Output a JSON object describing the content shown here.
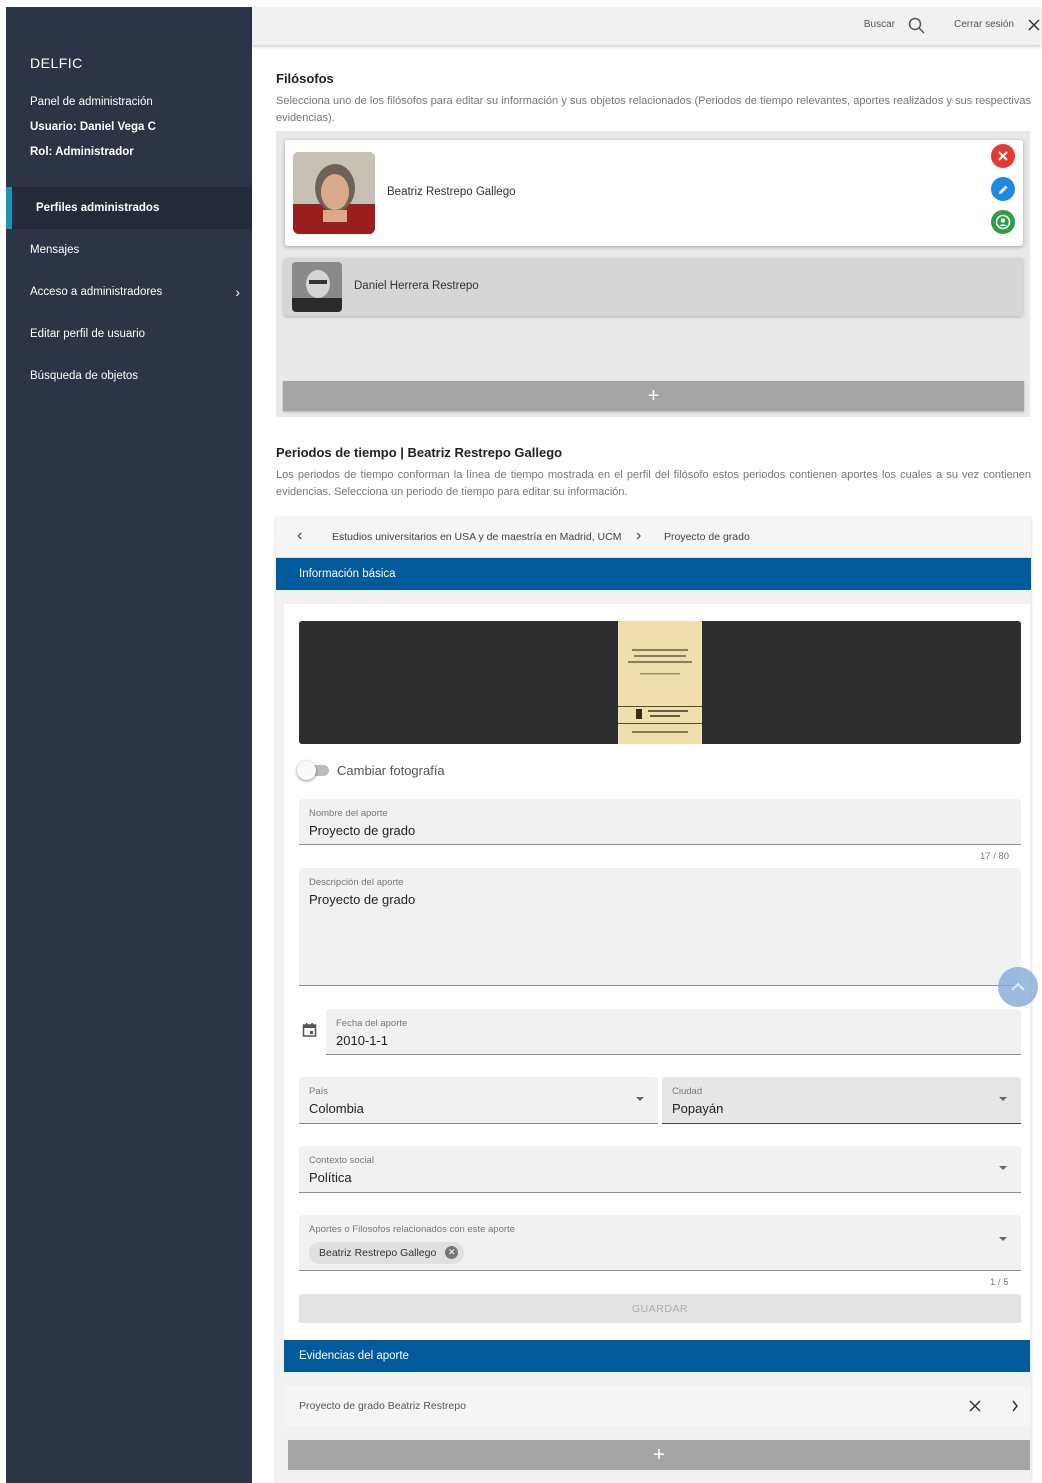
{
  "sidebar": {
    "brand": "DELFIC",
    "panel": "Panel de administración",
    "user": "Usuario: Daniel Vega C",
    "role": "Rol: Administrador",
    "items": [
      {
        "label": "Perfiles administrados"
      },
      {
        "label": "Mensajes"
      },
      {
        "label": "Acceso a administradores"
      },
      {
        "label": "Editar perfil de usuario"
      },
      {
        "label": "Búsqueda de objetos"
      }
    ]
  },
  "topbar": {
    "search_label": "Buscar",
    "logout_label": "Cerrar sesión"
  },
  "philosophers": {
    "title": "Filósofos",
    "description": "Selecciona uno de los filósofos para editar su información y sus objetos relacionados (Periodos de tiempo relevantes, aportes realizados y sus respectivas evidencias).",
    "list": [
      {
        "name": "Beatriz Restrepo Gallego"
      },
      {
        "name": "Daniel Herrera Restrepo"
      }
    ],
    "add_label": "+"
  },
  "periods": {
    "title": "Periodos de tiempo | Beatriz Restrepo Gallego",
    "description": "Los periodos de tiempo conforman la línea de tiempo mostrada en el perfil del filósofo estos periodos contienen aportes los cuales a su vez contienen evidencias. Selecciona un periodo de tiempo para editar su información.",
    "prev_period": "Estudios universitarios en USA y de maestría en Madrid, UCM",
    "current_period": "Proyecto de grado"
  },
  "basic_info": {
    "header": "Información básica",
    "change_photo": "Cambiar fotografía",
    "name_label": "Nombre del aporte",
    "name_value": "Proyecto de grado",
    "name_counter": "17 / 80",
    "desc_label": "Descripción del aporte",
    "desc_value": "Proyecto de grado",
    "date_label": "Fecha del aporte",
    "date_value": "2010-1-1",
    "country_label": "País",
    "country_value": "Colombia",
    "city_label": "Ciudad",
    "city_value": "Popayán",
    "context_label": "Contexto social",
    "context_value": "Política",
    "related_label": "Aportes o Filosofos relacionados con este aporte",
    "related_chip": "Beatriz Restrepo Gallego",
    "related_counter": "1 / 5",
    "save_label": "GUARDAR"
  },
  "evidences": {
    "header": "Evidencias del aporte",
    "items": [
      {
        "label": "Proyecto de grado Beatriz Restrepo"
      }
    ],
    "add_label": "+"
  }
}
